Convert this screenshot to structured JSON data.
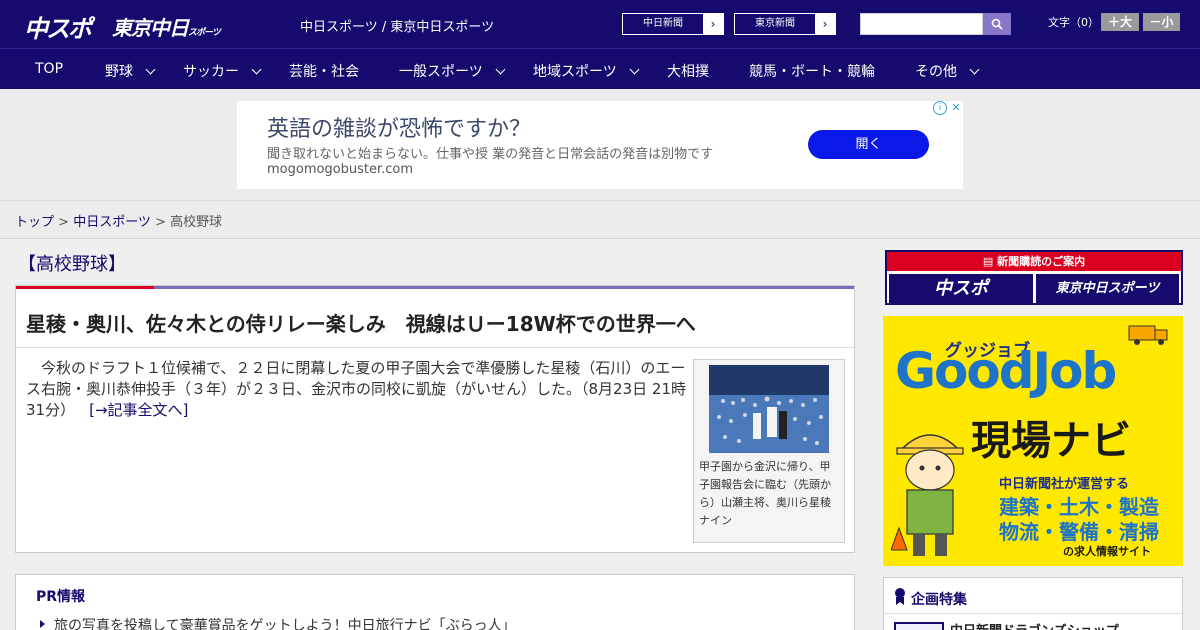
{
  "header": {
    "logo_chuspo": "中スポ",
    "logo_tokyo": "東京中日",
    "logo_tokyo_small": "スポーツ",
    "site_title": "中日スポーツ / 東京中日スポーツ",
    "paper_links": [
      "中日新聞",
      "東京新聞"
    ],
    "search_placeholder": "",
    "font_size_label": "文字（0）",
    "font_bigger": "＋大",
    "font_smaller": "－小"
  },
  "nav": [
    {
      "label": "TOP"
    },
    {
      "label": "野球"
    },
    {
      "label": "サッカー"
    },
    {
      "label": "芸能・社会"
    },
    {
      "label": "一般スポーツ"
    },
    {
      "label": "地域スポーツ"
    },
    {
      "label": "大相撲"
    },
    {
      "label": "競馬・ボート・競輪"
    },
    {
      "label": "その他"
    }
  ],
  "ad": {
    "headline": "英語の雑談が恐怖ですか？",
    "description": "聞き取れないと始まらない。仕事や授 業の発音と日常会話の発音は別物です",
    "url": "mogomogobuster.com",
    "button": "開く",
    "info": "i",
    "close": "✕"
  },
  "breadcrumb": {
    "home": "トップ",
    "sep": " > ",
    "parent": "中日スポーツ",
    "current": "高校野球"
  },
  "article": {
    "section": "【高校野球】",
    "title": "星稜・奥川、佐々木との侍リレー楽しみ　視線はＵー18W杯での世界一へ",
    "body": "今秋のドラフト１位候補で、２２日に閉幕した夏の甲子園大会で準優勝した星稜（石川）のエース右腕・奥川恭伸投手（３年）が２３日、金沢市の同校に凱旋（がいせん）した。（8月23日 21時31分）",
    "read_more": "[→記事全文へ]",
    "photo_caption": "甲子園から金沢に帰り、甲子園報告会に臨む（先頭から）山瀬主将、奥川ら星稜ナイン"
  },
  "pr": {
    "title": "PR情報",
    "items": [
      "旅の写真を投稿して豪華賞品をゲットしよう！中日旅行ナビ「ぶらっ人」"
    ]
  },
  "sidebar": {
    "subscription_head": "新聞購読のご案内",
    "sub_logo_1": "中スポ",
    "sub_logo_2": "東京中日スポーツ",
    "goodjob": {
      "kana": "グッジョブ",
      "logo": "GoodJob",
      "nav": "現場ナビ",
      "line1": "中日新聞社が運営する",
      "line2": "建築・土木・製造",
      "line3": "物流・警備・清掃",
      "line4": "の求人情報サイト"
    },
    "feature_title": "企画特集",
    "feature_item": "中日新聞ドラゴンズショップ"
  },
  "colors": {
    "brand_navy": "#150a6e",
    "accent_red": "#d90020",
    "accent_purple": "#7d6cba",
    "ad_button_blue": "#0a18e8",
    "goodjob_yellow": "#ffe800"
  }
}
